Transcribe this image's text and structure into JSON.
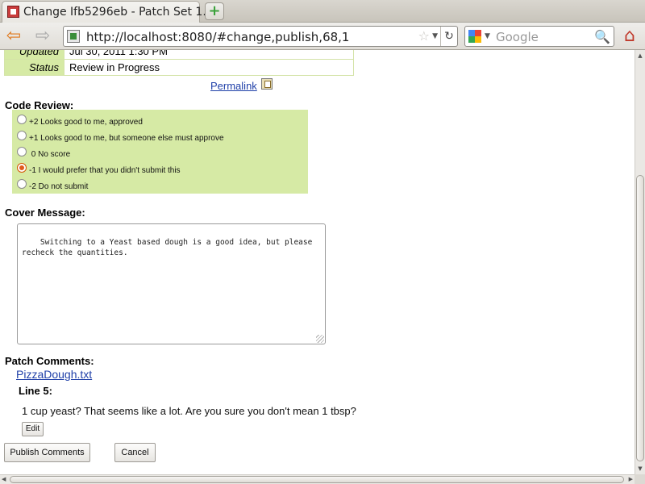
{
  "browser": {
    "tab_title": "Change Ifb5296eb - Patch Set 1...",
    "new_tab_symbol": "+",
    "url": "http://localhost:8080/#change,publish,68,1",
    "search_placeholder": "Google",
    "icons": [
      "back-arrow-icon",
      "forward-arrow-icon",
      "bookmark-star-icon",
      "reload-icon",
      "google-search-engine-icon",
      "magnifier-search-icon",
      "home-icon"
    ]
  },
  "info": {
    "rows": [
      {
        "label": "Updated",
        "value": "Jul 30, 2011 1:30 PM"
      },
      {
        "label": "Status",
        "value": "Review in Progress"
      }
    ],
    "permalink": "Permalink"
  },
  "code_review": {
    "title": "Code Review:",
    "options": [
      {
        "label": "+2 Looks good to me, approved",
        "checked": false
      },
      {
        "label": "+1 Looks good to me, but someone else must approve",
        "checked": false
      },
      {
        "label": " 0 No score",
        "checked": false
      },
      {
        "label": "-1 I would prefer that you didn't submit this",
        "checked": true
      },
      {
        "label": "-2 Do not submit",
        "checked": false
      }
    ]
  },
  "cover_message": {
    "title": "Cover Message:",
    "text": "Switching to a Yeast based dough is a good idea, but please\nrecheck the quantities."
  },
  "patch_comments": {
    "title": "Patch Comments:",
    "file": "PizzaDough.txt",
    "line_label": "Line 5:",
    "comment": "1 cup yeast? That seems like a lot. Are you sure you don't mean 1 tbsp?",
    "edit_label": "Edit"
  },
  "actions": {
    "publish": "Publish Comments",
    "cancel": "Cancel"
  }
}
